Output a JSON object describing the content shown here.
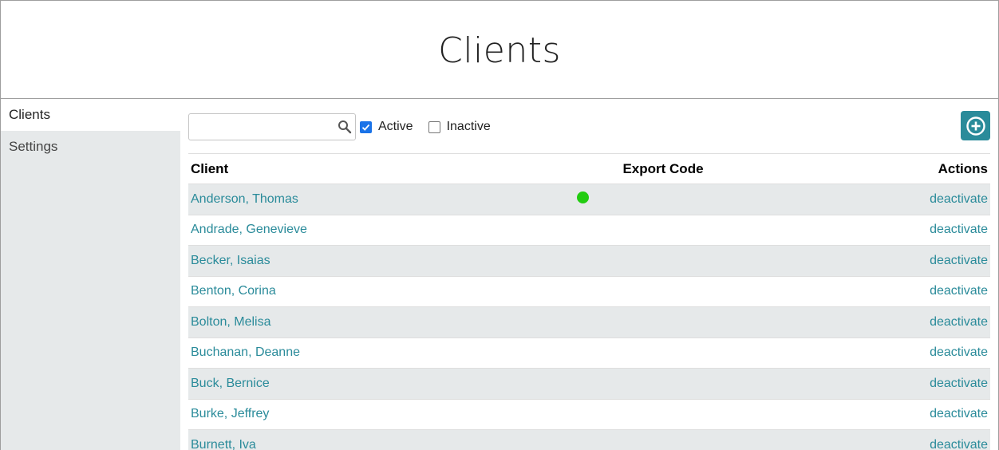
{
  "header": {
    "title": "Clients"
  },
  "sidebar": {
    "items": [
      {
        "label": "Clients",
        "active": true
      },
      {
        "label": "Settings",
        "active": false
      }
    ]
  },
  "toolbar": {
    "search": {
      "value": "",
      "placeholder": ""
    },
    "search_icon": "search-icon",
    "filters": [
      {
        "label": "Active",
        "checked": true
      },
      {
        "label": "Inactive",
        "checked": false
      }
    ],
    "add_icon": "add-circle-icon"
  },
  "table": {
    "columns": {
      "client": "Client",
      "export_code": "Export Code",
      "actions": "Actions"
    },
    "rows": [
      {
        "name": "Anderson, Thomas",
        "status_dot": true,
        "action": "deactivate"
      },
      {
        "name": "Andrade, Genevieve",
        "status_dot": false,
        "action": "deactivate"
      },
      {
        "name": "Becker, Isaias",
        "status_dot": false,
        "action": "deactivate"
      },
      {
        "name": "Benton, Corina",
        "status_dot": false,
        "action": "deactivate"
      },
      {
        "name": "Bolton, Melisa",
        "status_dot": false,
        "action": "deactivate"
      },
      {
        "name": "Buchanan, Deanne",
        "status_dot": false,
        "action": "deactivate"
      },
      {
        "name": "Buck, Bernice",
        "status_dot": false,
        "action": "deactivate"
      },
      {
        "name": "Burke, Jeffrey",
        "status_dot": false,
        "action": "deactivate"
      },
      {
        "name": "Burnett, Iva",
        "status_dot": false,
        "action": "deactivate"
      }
    ]
  },
  "colors": {
    "accent": "#2a8b9a",
    "status_green": "#22cc11",
    "stripe": "#e6e9ea"
  }
}
